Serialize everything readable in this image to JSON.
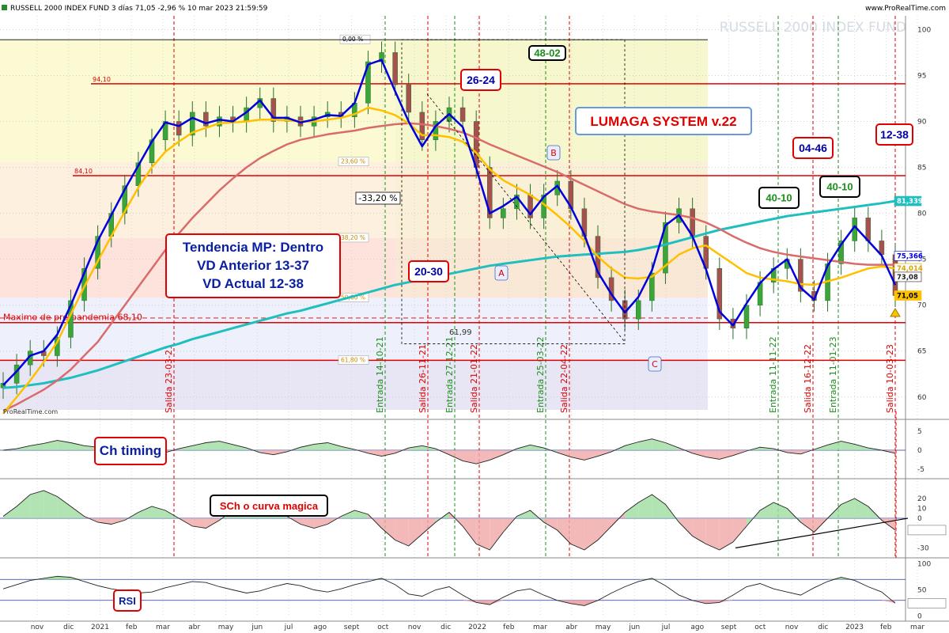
{
  "header": {
    "title": "RUSSELL 2000 INDEX FUND 3 días 71,05 -2,96 % 10 mar 2023 21:59:59",
    "source": "www.ProRealTime.com",
    "watermark": "RUSSELL 2000 INDEX FUND",
    "credit": "ProRealTime.com"
  },
  "colors": {
    "price": "#1b7a1b",
    "ma_fast": "#0000dd",
    "ma_mid": "#ffc000",
    "ma_slow": "#d96b6b",
    "ma_long": "#1fbfbf",
    "red": "#e00000",
    "green_dash": "#1b8f1b"
  },
  "chart_data": [
    {
      "type": "line",
      "name": "price-panel",
      "x_ticks": [
        "nov",
        "dic",
        "2021",
        "feb",
        "mar",
        "abr",
        "may",
        "jun",
        "jul",
        "ago",
        "sept",
        "oct",
        "nov",
        "dic",
        "2022",
        "feb",
        "mar",
        "abr",
        "may",
        "jun",
        "jul",
        "ago",
        "sept",
        "oct",
        "nov",
        "dic",
        "2023",
        "feb",
        "mar"
      ],
      "y_ticks": [
        "100",
        "95",
        "90",
        "85",
        "80",
        "75",
        "70",
        "65",
        "60"
      ],
      "ylim": [
        58,
        101.5
      ],
      "grid": true,
      "series": [
        {
          "key": "price",
          "type": "candlestick",
          "values": [
            61.5,
            63.5,
            65.0,
            64.5,
            66.5,
            70.5,
            74.0,
            77.5,
            80.0,
            83.0,
            85.5,
            88.0,
            90.0,
            88.5,
            91.0,
            89.5,
            90.5,
            90.0,
            91.5,
            92.5,
            90.0,
            90.5,
            89.5,
            90.5,
            91.0,
            90.5,
            92.0,
            96.5,
            97.5,
            94.0,
            91.0,
            88.0,
            90.0,
            91.5,
            90.0,
            85.0,
            79.5,
            80.5,
            82.0,
            79.5,
            82.0,
            83.5,
            80.5,
            77.5,
            73.0,
            70.5,
            68.5,
            70.5,
            73.5,
            79.0,
            80.5,
            77.5,
            74.0,
            68.5,
            67.5,
            70.0,
            72.5,
            74.0,
            75.0,
            71.5,
            70.5,
            74.5,
            77.0,
            79.5,
            77.0,
            75.5,
            71.05
          ]
        },
        {
          "key": "ma_fast",
          "values": [
            61.3,
            62.8,
            64.5,
            65.0,
            66.8,
            70.0,
            73.5,
            77.0,
            79.8,
            82.6,
            85.2,
            87.8,
            89.9,
            89.5,
            90.4,
            89.8,
            90.2,
            90.0,
            91.0,
            92.3,
            90.4,
            90.4,
            89.9,
            90.2,
            90.7,
            90.6,
            92.0,
            96.2,
            96.7,
            93.3,
            90.0,
            87.3,
            89.5,
            90.8,
            89.4,
            84.9,
            80.0,
            80.8,
            81.8,
            79.9,
            81.8,
            83.0,
            80.7,
            77.7,
            73.6,
            71.2,
            69.2,
            70.9,
            73.8,
            78.7,
            79.8,
            77.5,
            73.9,
            69.3,
            67.8,
            70.2,
            72.4,
            73.9,
            75.0,
            71.9,
            70.6,
            74.3,
            76.6,
            78.6,
            77.0,
            75.4,
            72.2
          ]
        },
        {
          "key": "ma_mid",
          "values": [
            58.2,
            60.0,
            61.8,
            63.8,
            66.0,
            69.0,
            72.0,
            74.8,
            77.5,
            80.2,
            82.8,
            85.0,
            86.7,
            87.8,
            88.8,
            89.3,
            89.8,
            89.9,
            90.0,
            90.2,
            90.2,
            90.1,
            90.0,
            90.0,
            90.2,
            90.4,
            90.8,
            91.5,
            91.2,
            90.7,
            89.8,
            88.5,
            88.5,
            88.3,
            87.8,
            86.6,
            84.8,
            83.6,
            82.8,
            82.0,
            81.0,
            79.8,
            78.5,
            77.0,
            75.3,
            74.0,
            73.0,
            72.9,
            73.1,
            74.3,
            75.5,
            76.2,
            76.5,
            75.5,
            74.5,
            73.5,
            73.0,
            72.8,
            72.6,
            72.3,
            72.2,
            72.6,
            73.0,
            73.5,
            74.0,
            74.2,
            74.0
          ]
        },
        {
          "key": "ma_slow",
          "values": [
            58.5,
            59.2,
            60.0,
            60.8,
            61.8,
            63.0,
            64.5,
            66.0,
            68.0,
            70.0,
            72.0,
            74.0,
            76.0,
            77.8,
            79.5,
            81.0,
            82.5,
            83.8,
            85.0,
            86.0,
            86.8,
            87.5,
            88.0,
            88.3,
            88.6,
            88.8,
            89.0,
            89.3,
            89.5,
            89.7,
            89.8,
            89.7,
            89.5,
            89.2,
            88.8,
            88.2,
            87.5,
            86.9,
            86.3,
            85.7,
            85.1,
            84.5,
            83.8,
            83.1,
            82.4,
            81.7,
            81.0,
            80.5,
            80.2,
            80.0,
            79.8,
            79.5,
            79.0,
            78.3,
            77.5,
            76.8,
            76.2,
            75.8,
            75.5,
            75.3,
            75.1,
            74.9,
            74.7,
            74.5,
            74.4,
            74.4,
            74.4
          ]
        },
        {
          "key": "ma_long",
          "values": [
            61.0,
            61.1,
            61.3,
            61.5,
            61.8,
            62.1,
            62.5,
            62.9,
            63.4,
            63.9,
            64.4,
            64.9,
            65.4,
            65.8,
            66.3,
            66.7,
            67.1,
            67.5,
            67.9,
            68.3,
            68.7,
            69.1,
            69.4,
            69.8,
            70.2,
            70.6,
            71.0,
            71.4,
            71.8,
            72.2,
            72.5,
            72.8,
            73.1,
            73.4,
            73.7,
            74.0,
            74.3,
            74.5,
            74.7,
            74.9,
            75.1,
            75.3,
            75.4,
            75.5,
            75.6,
            75.7,
            75.8,
            76.0,
            76.3,
            76.6,
            77.0,
            77.4,
            77.8,
            78.2,
            78.5,
            78.8,
            79.1,
            79.4,
            79.7,
            79.9,
            80.1,
            80.3,
            80.5,
            80.7,
            80.9,
            81.1,
            81.339
          ]
        }
      ],
      "horizontal_lines": [
        {
          "value": 94.1,
          "label": "94,10"
        },
        {
          "value": 84.1,
          "label": "84,10"
        },
        {
          "value": 68.1,
          "label": "Maximo de pre-pandemia 68,10"
        },
        {
          "value": 64.0,
          "label": ""
        }
      ],
      "fib_levels": [
        {
          "label": "0,00 %",
          "value": 98.9
        },
        {
          "label": "23,60 %",
          "value": 85.6
        },
        {
          "label": "38,20 %",
          "value": 77.3
        },
        {
          "label": "50,00 %",
          "value": 70.8
        },
        {
          "label": "61,80 %",
          "value": 64.0
        }
      ],
      "price_labels": [
        {
          "text": "81,339",
          "value": 81.339,
          "bg": "#1fbfbf",
          "fg": "#ffffff"
        },
        {
          "text": "75,366",
          "value": 75.366,
          "bg": "#ffffff",
          "fg": "#0000dd"
        },
        {
          "text": "74,014",
          "value": 74.014,
          "bg": "#ffffff",
          "fg": "#d9a400"
        },
        {
          "text": "73,08",
          "value": 73.08,
          "bg": "#ffffff",
          "fg": "#222222"
        },
        {
          "text": "71,05",
          "value": 71.05,
          "bg": "#ffc000",
          "fg": "#000000"
        }
      ],
      "vertical_labels": [
        {
          "text": "Salida 23-03-21",
          "color": "red"
        },
        {
          "text": "Entrada 14-10-21",
          "color": "green"
        },
        {
          "text": "Salida 26-11-21",
          "color": "red"
        },
        {
          "text": "Entrada 27-12-21",
          "color": "green"
        },
        {
          "text": "Salida 21-01-22",
          "color": "red"
        },
        {
          "text": "Entrada 25-03-22",
          "color": "green"
        },
        {
          "text": "Salida 22-04-22",
          "color": "red"
        },
        {
          "text": "Entrada 11-11-22",
          "color": "green"
        },
        {
          "text": "Salida 16-12-22",
          "color": "red"
        },
        {
          "text": "Entrada 11-01-23",
          "color": "green"
        },
        {
          "text": "Salida 10-03-23",
          "color": "red"
        }
      ],
      "annotations": [
        {
          "text": "-33,20 %",
          "style": "plain"
        },
        {
          "text": "48-02",
          "style": "green-box"
        },
        {
          "text": "26-24",
          "style": "red-box"
        },
        {
          "text": "20-30",
          "style": "red-box"
        },
        {
          "text": "40-10",
          "style": "green-box"
        },
        {
          "text": "40-10",
          "style": "green-box"
        },
        {
          "text": "04-46",
          "style": "red-box"
        },
        {
          "text": "12-38",
          "style": "red-box"
        },
        {
          "text": "LUMAGA SYSTEM v.22",
          "style": "title-box"
        },
        {
          "text": "Tendencia MP: Dentro",
          "style": "info"
        },
        {
          "text": "VD Anterior 13-37",
          "style": "info"
        },
        {
          "text": "VD Actual  12-38",
          "style": "info"
        },
        {
          "text": "A",
          "style": "wave"
        },
        {
          "text": "B",
          "style": "wave"
        },
        {
          "text": "C",
          "style": "wave"
        },
        {
          "text": "61,99",
          "style": "small"
        }
      ]
    },
    {
      "type": "area",
      "name": "Ch timing",
      "y_ticks": [
        "5",
        "0",
        "-5"
      ],
      "ylim": [
        -6.5,
        6.5
      ],
      "values": [
        0,
        0.4,
        1.2,
        1.8,
        2.6,
        2.0,
        1.2,
        0.8,
        0.5,
        -0.3,
        -1.0,
        -1.2,
        -0.6,
        0.4,
        1.2,
        2.0,
        2.4,
        1.5,
        0.6,
        -0.6,
        -1.2,
        -0.4,
        0.8,
        1.6,
        2.0,
        1.0,
        0.2,
        -0.8,
        -1.6,
        -0.8,
        0.6,
        1.2,
        0.4,
        -1.2,
        -2.8,
        -3.6,
        -2.6,
        -1.2,
        0.4,
        1.4,
        0.6,
        -0.6,
        -1.8,
        -2.6,
        -1.6,
        -0.4,
        1.2,
        2.2,
        3.0,
        2.0,
        0.6,
        -0.8,
        -1.8,
        -2.4,
        -1.4,
        -0.2,
        0.8,
        0.4,
        -0.6,
        -1.0,
        0.2,
        1.4,
        2.4,
        1.6,
        0.6,
        0,
        -0.8
      ]
    },
    {
      "type": "area",
      "name": "SCh o curva magica",
      "y_ticks": [
        "20",
        "10",
        "0",
        "-11,947",
        "-30"
      ],
      "ylim": [
        -36,
        36
      ],
      "values": [
        2,
        12,
        24,
        28,
        22,
        12,
        2,
        -4,
        -6,
        -2,
        6,
        12,
        8,
        0,
        -8,
        -10,
        -2,
        8,
        14,
        18,
        10,
        2,
        -6,
        -10,
        -6,
        2,
        8,
        4,
        -10,
        -22,
        -28,
        -16,
        -4,
        6,
        -8,
        -26,
        -32,
        -14,
        2,
        8,
        -4,
        -12,
        -26,
        -32,
        -22,
        -8,
        6,
        16,
        24,
        14,
        -4,
        -18,
        -26,
        -32,
        -24,
        -8,
        8,
        16,
        10,
        -4,
        -14,
        0,
        14,
        20,
        12,
        -2,
        -11.947
      ]
    },
    {
      "type": "line",
      "name": "RSI",
      "y_ticks": [
        "100",
        "50",
        "0"
      ],
      "ylim": [
        -2,
        102
      ],
      "overbought": 70,
      "oversold": 30,
      "values": [
        52,
        60,
        68,
        72,
        76,
        74,
        66,
        58,
        52,
        48,
        44,
        46,
        54,
        60,
        66,
        64,
        56,
        50,
        44,
        48,
        56,
        62,
        58,
        50,
        46,
        52,
        60,
        66,
        72,
        60,
        42,
        38,
        50,
        56,
        40,
        26,
        22,
        36,
        48,
        52,
        40,
        30,
        24,
        20,
        30,
        44,
        56,
        66,
        72,
        58,
        40,
        30,
        24,
        26,
        40,
        56,
        62,
        52,
        46,
        40,
        54,
        66,
        74,
        68,
        56,
        46,
        24.718
      ]
    }
  ]
}
